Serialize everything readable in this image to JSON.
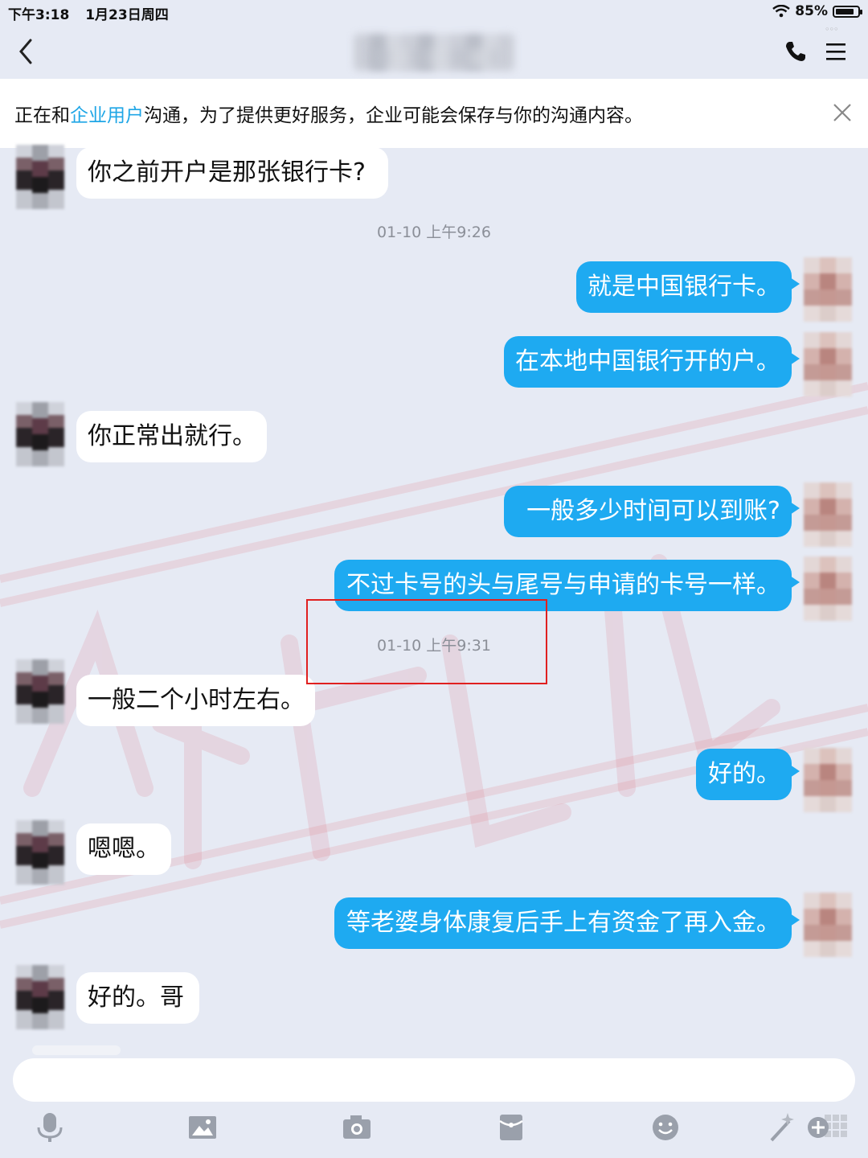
{
  "status_bar": {
    "time": "下午3:18",
    "date": "1月23日周四",
    "battery": "85%",
    "battery_level": 0.85
  },
  "notice": {
    "prefix": "正在和",
    "link": "企业用户",
    "suffix": "沟通，为了提供更好服务，企业可能会保存与你的沟通内容。"
  },
  "messages": [
    {
      "side": "left",
      "text": "你之前开户是那张银行卡?"
    },
    {
      "side": "time",
      "text": "01-10 上午9:26"
    },
    {
      "side": "right",
      "text": "就是中国银行卡。"
    },
    {
      "side": "right",
      "text": "在本地中国银行开的户。"
    },
    {
      "side": "left",
      "text": "你正常出就行。"
    },
    {
      "side": "right",
      "text": "一般多少时间可以到账?"
    },
    {
      "side": "right",
      "text": "不过卡号的头与尾号与申请的卡号一样。"
    },
    {
      "side": "time",
      "text": "01-10 上午9:31"
    },
    {
      "side": "left",
      "text": "一般二个小时左右。"
    },
    {
      "side": "right",
      "text": "好的。"
    },
    {
      "side": "left",
      "text": "嗯嗯。"
    },
    {
      "side": "right",
      "text": "等老婆身体康复后手上有资金了再入金。"
    },
    {
      "side": "left",
      "text": "好的。哥"
    }
  ],
  "colors": {
    "accent": "#1eaaf1",
    "link": "#1fa6e6",
    "highlight": "#e02020",
    "background": "#e6eaf4"
  },
  "toolbar_icons": [
    "microphone-icon",
    "image-icon",
    "camera-icon",
    "red-packet-icon",
    "emoji-icon",
    "magic-wand-icon",
    "more-grid-icon"
  ]
}
